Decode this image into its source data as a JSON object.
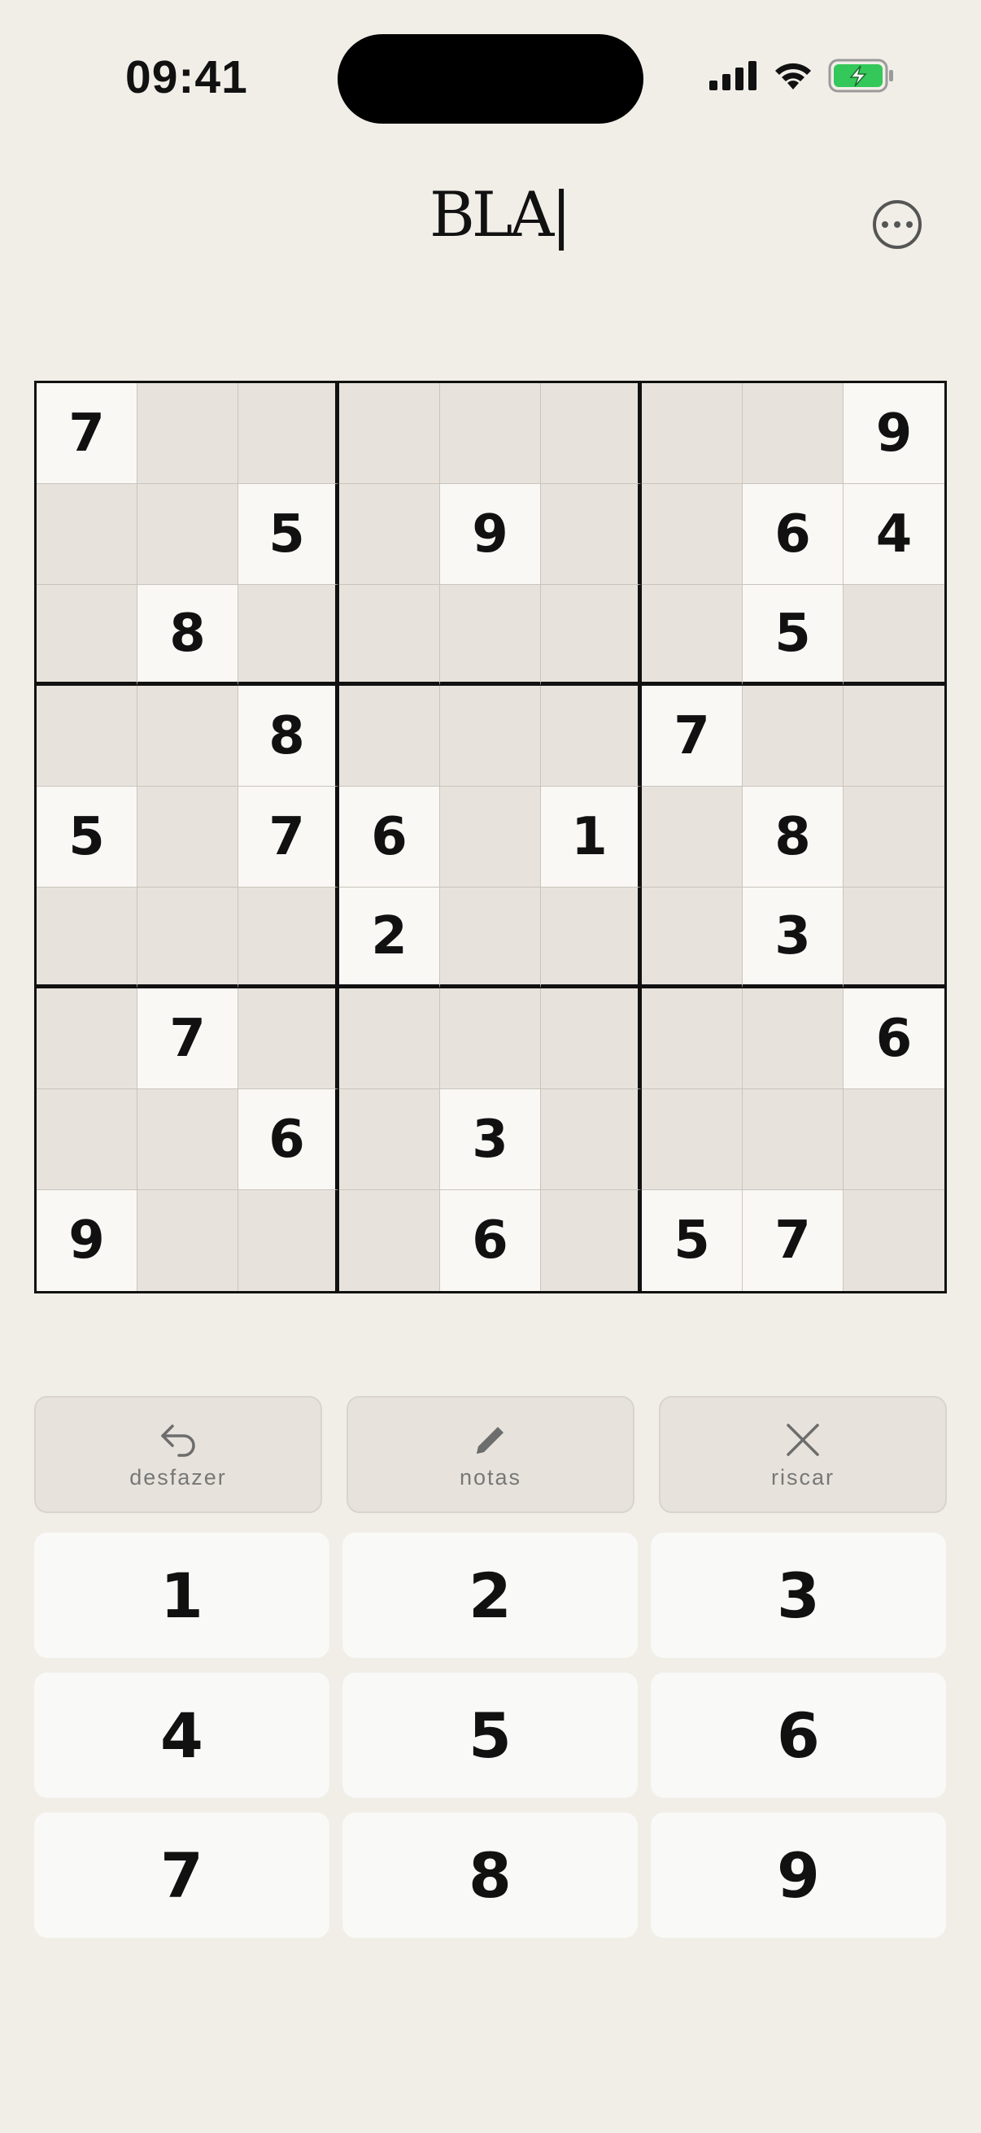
{
  "status_bar": {
    "time": "09:41",
    "battery_color": "#34c759"
  },
  "header": {
    "logo_text": "BLA|"
  },
  "board": {
    "rows": [
      [
        "7",
        "",
        "",
        "",
        "",
        "",
        "",
        "",
        "9"
      ],
      [
        "",
        "",
        "5",
        "",
        "9",
        "",
        "",
        "6",
        "4"
      ],
      [
        "",
        "8",
        "",
        "",
        "",
        "",
        "",
        "5",
        ""
      ],
      [
        "",
        "",
        "8",
        "",
        "",
        "",
        "7",
        "",
        ""
      ],
      [
        "5",
        "",
        "7",
        "6",
        "",
        "1",
        "",
        "8",
        ""
      ],
      [
        "",
        "",
        "",
        "2",
        "",
        "",
        "",
        "3",
        ""
      ],
      [
        "",
        "7",
        "",
        "",
        "",
        "",
        "",
        "",
        "6"
      ],
      [
        "",
        "",
        "6",
        "",
        "3",
        "",
        "",
        "",
        ""
      ],
      [
        "9",
        "",
        "",
        "",
        "6",
        "",
        "5",
        "7",
        ""
      ]
    ]
  },
  "tools": {
    "undo_label": "desfazer",
    "notes_label": "notas",
    "erase_label": "riscar"
  },
  "keypad": {
    "keys": [
      "1",
      "2",
      "3",
      "4",
      "5",
      "6",
      "7",
      "8",
      "9"
    ]
  },
  "colors": {
    "background": "#f1eee8",
    "empty_cell": "#e7e3dc",
    "given_cell": "#f9f8f5",
    "key": "#f9f9f7"
  }
}
